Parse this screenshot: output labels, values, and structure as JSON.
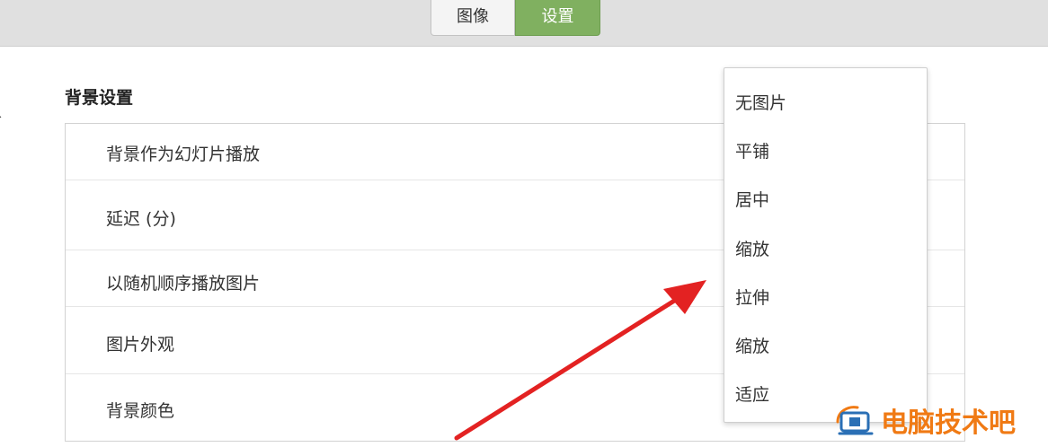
{
  "tabs": [
    {
      "label": "图像",
      "active": false
    },
    {
      "label": "设置",
      "active": true
    }
  ],
  "section": {
    "title": "背景设置"
  },
  "rows": [
    {
      "label": "背景作为幻灯片播放"
    },
    {
      "label": "延迟 (分)"
    },
    {
      "label": "以随机顺序播放图片"
    },
    {
      "label": "图片外观"
    },
    {
      "label": "背景颜色"
    }
  ],
  "dropdown": {
    "options": [
      "无图片",
      "平铺",
      "居中",
      "缩放",
      "拉伸",
      "缩放",
      "适应"
    ]
  },
  "watermark": {
    "text": "电脑技术吧"
  },
  "colors": {
    "accent": "#80b060",
    "arrow": "#e32222",
    "watermark": "#f07a14"
  }
}
